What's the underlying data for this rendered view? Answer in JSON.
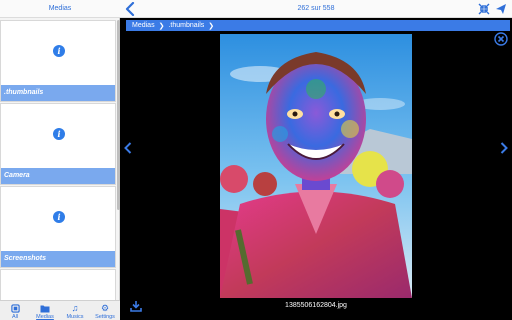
{
  "sidebar": {
    "title": "Medias",
    "folders": [
      {
        "label": ""
      },
      {
        "label": ".thumbnails"
      },
      {
        "label": "Camera"
      },
      {
        "label": "Screenshots"
      }
    ],
    "tabs": [
      {
        "label": "All",
        "icon": "all-icon"
      },
      {
        "label": "Medias",
        "icon": "folder-icon"
      },
      {
        "label": "Musics",
        "icon": "music-icon"
      },
      {
        "label": "Settings",
        "icon": "gear-icon"
      }
    ],
    "active_tab": "Medias"
  },
  "viewer": {
    "counter": "262 sur 558",
    "breadcrumb": [
      "Medias",
      ".thumbnails"
    ],
    "filename": "1385506162804.jpg"
  },
  "colors": {
    "accent": "#2f6fd8",
    "label_bg": "#7aa9ee",
    "breadcrumb_bg": "#3b7be6"
  }
}
